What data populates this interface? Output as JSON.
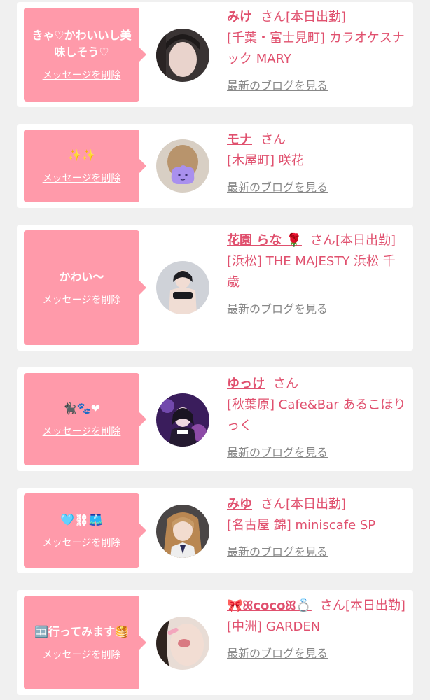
{
  "delete_label": "メッセージを削除",
  "blog_label": "最新のブログを見る",
  "san_label": "さん",
  "items": [
    {
      "message": "きゃ♡かわいいし美味しそう♡",
      "name": "みけ",
      "status": "[本日出勤]",
      "shop": "[千葉・富士見町] カラオケスナック MARY"
    },
    {
      "message": "✨✨",
      "name": "モナ",
      "status": "",
      "shop": "[木屋町] 咲花"
    },
    {
      "message": "かわい〜",
      "name": "花園 らな 🌹",
      "status": "[本日出勤]",
      "shop": "[浜松] THE MAJESTY 浜松 千歳"
    },
    {
      "message": "🐈‍⬛🐾❤",
      "name": "ゆっけ",
      "status": "",
      "shop": "[秋葉原] Cafe&Bar あるこほりっく"
    },
    {
      "message": "🩵⛓🩳",
      "name": "みゆ",
      "status": "[本日出勤]",
      "shop": "[名古屋 錦] miniscafe SP"
    },
    {
      "message": "🈁行ってみます🥞",
      "name": "🎀ꕤcocoꕤ💍",
      "status": "[本日出勤]",
      "shop": "[中洲] GARDEN"
    }
  ],
  "colors": {
    "accent": "#e0506e",
    "bubble": "#ff9aaa",
    "background": "#f0f0f0",
    "link_gray": "#888888"
  }
}
